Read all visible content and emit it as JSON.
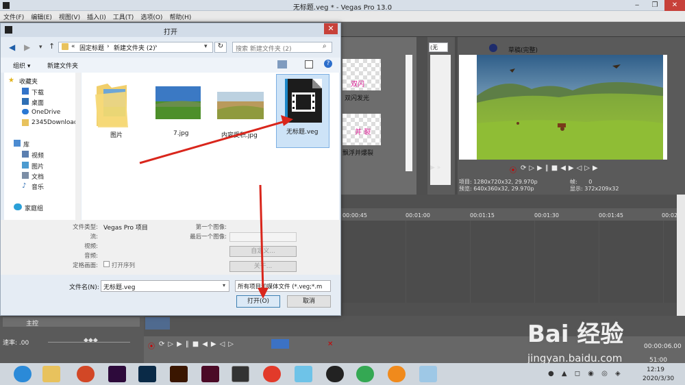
{
  "window": {
    "title": "无标题.veg * - Vegas Pro 13.0"
  },
  "menu": [
    "文件(F)",
    "编辑(E)",
    "视图(V)",
    "插入(I)",
    "工具(T)",
    "选项(O)",
    "帮助(H)"
  ],
  "dialog": {
    "title": "打开",
    "address": {
      "parts": [
        "«",
        "固定标题",
        "›",
        "新建文件夹 (2)",
        "›"
      ]
    },
    "search_placeholder": "搜索 新建文件夹 (2)",
    "toolbar": {
      "organize": "组织 ▾",
      "new_folder": "新建文件夹"
    },
    "nav": {
      "favorites": "收藏夹",
      "fav_items": [
        "下载",
        "桌面",
        "OneDrive",
        "2345Download"
      ],
      "library": "库",
      "lib_items": [
        "视频",
        "图片",
        "文档",
        "音乐"
      ],
      "homegroup": "家庭组"
    },
    "files": [
      {
        "name": "图片",
        "type": "folder"
      },
      {
        "name": "7.jpg",
        "type": "image"
      },
      {
        "name": "内容受积.jpg",
        "type": "image"
      },
      {
        "name": "无标题.veg",
        "type": "veg",
        "selected": true
      }
    ],
    "veg_icon_brand": "SONY",
    "details": {
      "file_type_label": "文件类型:",
      "file_type_value": "Vegas Pro 项目",
      "stream_label": "流:",
      "video_label": "视频:",
      "audio_label": "音频:",
      "still_label": "定格画面:",
      "open_seq": "打开序列",
      "first_image_label": "第一个图像:",
      "last_image_label": "最后一个图像:",
      "custom_btn": "自定义...",
      "about_btn": "关于..."
    },
    "filename_label": "文件名(N):",
    "filename_value": "无标题.veg",
    "filetype_filter": "所有项目和媒体文件 (*.veg;*.m",
    "open_button": "打开(O)",
    "cancel_button": "取消"
  },
  "transitions": [
    "双闪发光",
    "飘浮并爆裂"
  ],
  "transition_thumbs": [
    "双闪",
    "并 裂"
  ],
  "preview": {
    "label_dropdown": "(无",
    "quality": "草稿(完整)",
    "project_label": "项目:",
    "project_value": "1280x720x32, 29.970p",
    "preview_label": "预览:",
    "preview_value": "640x360x32, 29.970p",
    "frame_label": "帧:",
    "frame_value": "0",
    "display_label": "显示:",
    "display_value": "372x209x32"
  },
  "timeline": {
    "ticks": [
      "00:00:45",
      "00:01:00",
      "00:01:15",
      "00:01:30",
      "00:01:45",
      "00:02:00"
    ],
    "master_label": "主控",
    "rate_label": "速率: .00",
    "end_time": "00:00:06.00",
    "time_display": "51:00"
  },
  "watermark": {
    "logo": "Bai 经验",
    "url": "jingyan.baidu.com"
  },
  "taskbar": {
    "time": "12:19",
    "date": "2020/3/30"
  }
}
